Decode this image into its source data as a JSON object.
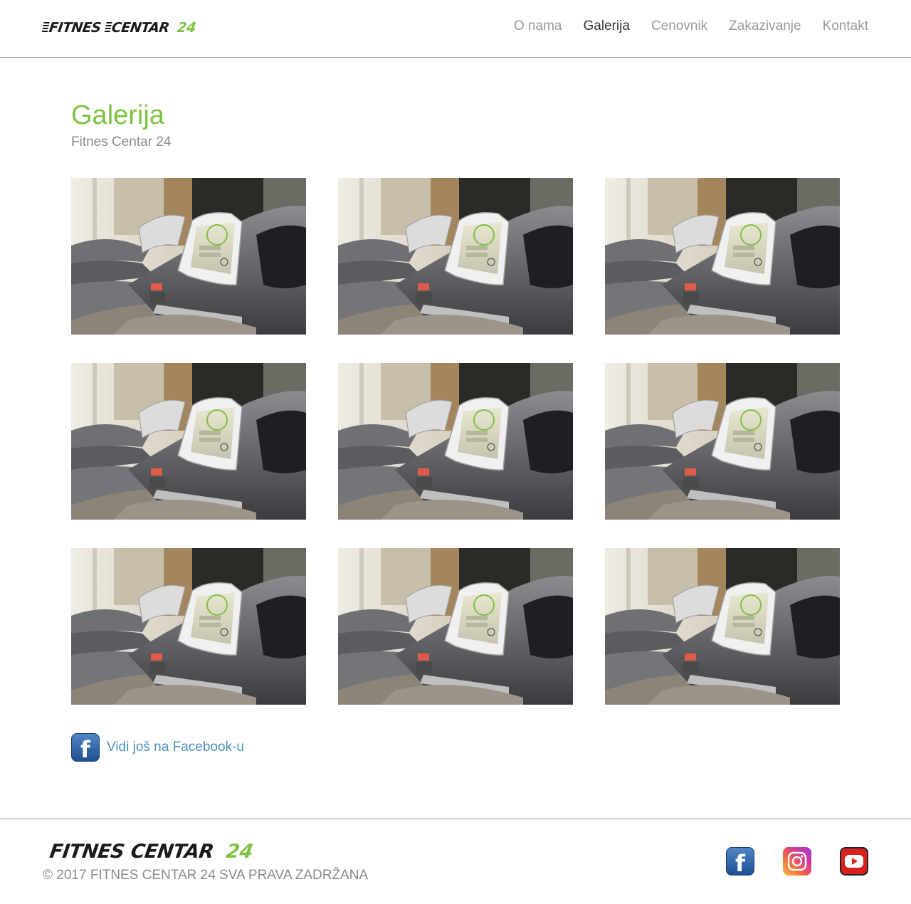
{
  "brand": {
    "name_part1": "FITNES",
    "name_part2": "CENTAR",
    "number": "24",
    "accent_color": "#7dc242"
  },
  "nav": {
    "items": [
      {
        "label": "O nama",
        "active": false
      },
      {
        "label": "Galerija",
        "active": true
      },
      {
        "label": "Cenovnik",
        "active": false
      },
      {
        "label": "Zakazivanje",
        "active": false
      },
      {
        "label": "Kontakt",
        "active": false
      }
    ]
  },
  "main": {
    "title": "Galerija",
    "subtitle": "Fitnes Centar 24",
    "gallery_count": 9,
    "facebook_link": "Vidi još na Facebook-u"
  },
  "footer": {
    "copyright": "© 2017  FITNES CENTAR 24 SVA PRAVA ZADRŽANA",
    "socials": [
      "facebook-icon",
      "instagram-icon",
      "youtube-icon"
    ]
  }
}
